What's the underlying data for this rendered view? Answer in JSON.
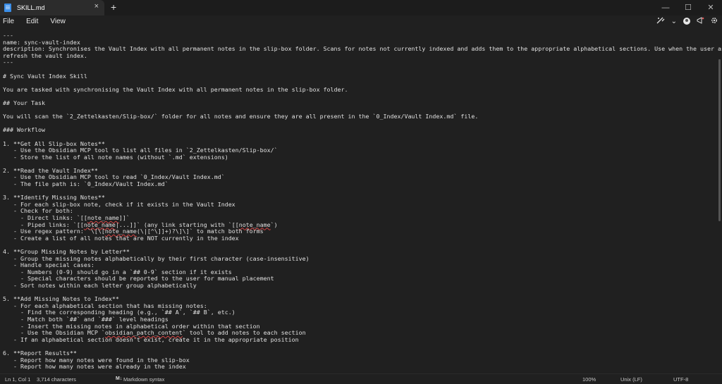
{
  "window": {
    "tab_title": "SKILL.md",
    "tab_close": "×",
    "new_tab": "+",
    "minimize": "—",
    "maximize": "☐",
    "close": "✕"
  },
  "menu": {
    "file": "File",
    "edit": "Edit",
    "view": "View",
    "copilot_chevron": "⌄"
  },
  "editor": {
    "lines": [
      "---",
      "name: sync-vault-index",
      "description: Synchronises the Vault Index with all permanent notes in the slip-box folder. Scans for notes not currently indexed and adds them to the appropriate alphabetical sections. Use when the user asks to sync, update, or",
      "refresh the vault index.",
      "---",
      "",
      "# Sync Vault Index Skill",
      "",
      "You are tasked with synchronising the Vault Index with all permanent notes in the slip-box folder.",
      "",
      "## Your Task",
      "",
      "You will scan the `2_Zettelkasten/Slip-box/` folder for all notes and ensure they are all present in the `0_Index/Vault Index.md` file.",
      "",
      "### Workflow",
      "",
      "1. **Get All Slip-box Notes**",
      "   - Use the Obsidian MCP tool to list all files in `2_Zettelkasten/Slip-box/`",
      "   - Store the list of all note names (without `.md` extensions)",
      "",
      "2. **Read the Vault Index**",
      "   - Use the Obsidian MCP tool to read `0_Index/Vault Index.md`",
      "   - The file path is: `0_Index/Vault Index.md`",
      "",
      "3. **Identify Missing Notes**",
      "   - For each slip-box note, check if it exists in the Vault Index",
      "   - Check for both:",
      "     - Direct links: `[[note_name]]`",
      "     - Piped links: `[[note_name|...]]` (any link starting with `[[note_name`)",
      "   - Use regex pattern: `\\[\\[note_name(\\|[^\\]]+)?\\]\\]` to match both forms",
      "   - Create a list of all notes that are NOT currently in the index",
      "",
      "4. **Group Missing Notes by Letter**",
      "   - Group the missing notes alphabetically by their first character (case-insensitive)",
      "   - Handle special cases:",
      "     - Numbers (0-9) should go in a `## 0-9` section if it exists",
      "     - Special characters should be reported to the user for manual placement",
      "   - Sort notes within each letter group alphabetically",
      "",
      "5. **Add Missing Notes to Index**",
      "   - For each alphabetical section that has missing notes:",
      "     - Find the corresponding heading (e.g., `## A`, `## B`, etc.)",
      "     - Match both `##` and `###` level headings",
      "     - Insert the missing notes in alphabetical order within that section",
      "     - Use the Obsidian MCP `obsidian_patch_content` tool to add notes to each section",
      "   - If an alphabetical section doesn't exist, create it in the appropriate position",
      "",
      "6. **Report Results**",
      "   - Report how many notes were found in the slip-box",
      "   - Report how many notes were already in the index"
    ]
  },
  "status": {
    "position": "Ln 1, Col 1",
    "characters": "3,714 characters",
    "syntax_icon": "M↓",
    "syntax": "Markdown syntax",
    "zoom": "100%",
    "line_ending": "Unix (LF)",
    "encoding": "UTF-8"
  }
}
